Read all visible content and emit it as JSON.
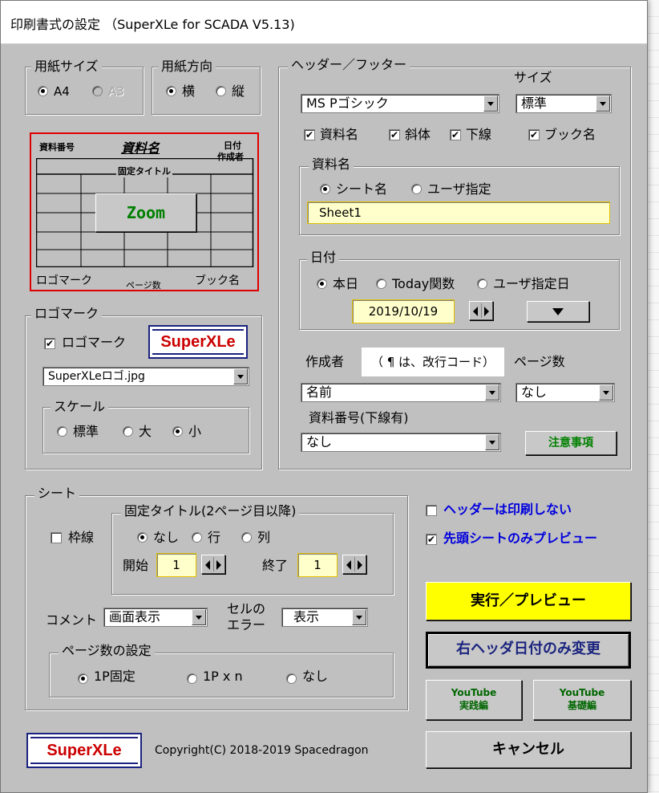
{
  "window": {
    "title": "印刷書式の設定 （SuperXLe for SCADA V5.13)"
  },
  "paper_size": {
    "legend": "用紙サイズ",
    "options": [
      "A4",
      "A3"
    ],
    "selected": "A4"
  },
  "paper_orientation": {
    "legend": "用紙方向",
    "options": [
      "横",
      "縦"
    ],
    "selected": "横"
  },
  "preview": {
    "doc_number": "資料番号",
    "doc_name": "資料名",
    "date": "日付",
    "author": "作成者",
    "fixed_title": "固定タイトル",
    "zoom_button": "Zoom",
    "logo_mark": "ロゴマーク",
    "page_count": "ページ数",
    "book_name": "ブック名"
  },
  "logo": {
    "legend": "ロゴマーク",
    "checkbox_label": "ロゴマーク",
    "checked": true,
    "badge_text": "SuperXLe",
    "file": "SuperXLeロゴ.jpg",
    "scale": {
      "legend": "スケール",
      "options": [
        "標準",
        "大",
        "小"
      ],
      "selected": "小"
    }
  },
  "header_footer": {
    "legend": "ヘッダー／フッター",
    "size_label": "サイズ",
    "font": "MS Pゴシック",
    "size": "標準",
    "checks": [
      {
        "label": "資料名",
        "checked": true
      },
      {
        "label": "斜体",
        "checked": true
      },
      {
        "label": "下線",
        "checked": true
      },
      {
        "label": "ブック名",
        "checked": true
      }
    ],
    "doc_name": {
      "legend": "資料名",
      "options": [
        "シート名",
        "ユーザ指定"
      ],
      "selected": "シート名",
      "value": "Sheet1"
    },
    "date": {
      "legend": "日付",
      "options": [
        "本日",
        "Today関数",
        "ユーザ指定日"
      ],
      "selected": "本日",
      "value": "2019/10/19"
    },
    "author_label": "作成者",
    "author_hint": "（ ¶ は、改行コード）",
    "author_value": "名前",
    "pages_label": "ページ数",
    "pages_value": "なし",
    "doc_number_label": "資料番号(下線有)",
    "doc_number_value": "なし",
    "notes_button": "注意事項"
  },
  "sheet": {
    "legend": "シート",
    "border_label": "枠線",
    "border_checked": false,
    "fixed_title": {
      "legend": "固定タイトル(2ページ目以降)",
      "options": [
        "なし",
        "行",
        "列"
      ],
      "selected": "なし",
      "start_label": "開始",
      "start_value": "1",
      "end_label": "終了",
      "end_value": "1"
    },
    "comment_label": "コメント",
    "comment_value": "画面表示",
    "cell_error_label_1": "セルの",
    "cell_error_label_2": "エラー",
    "cell_error_value": "表示",
    "page_setting": {
      "legend": "ページ数の設定",
      "options": [
        "1P固定",
        "1P x n",
        "なし"
      ],
      "selected": "1P固定"
    }
  },
  "options": {
    "no_header_print": {
      "label": "ヘッダーは印刷しない",
      "checked": false
    },
    "first_sheet_preview": {
      "label": "先頭シートのみプレビュー",
      "checked": true
    }
  },
  "buttons": {
    "run_preview": "実行／プレビュー",
    "right_header_date": "右ヘッダ日付のみ変更",
    "youtube_practice_1": "YouTube",
    "youtube_practice_2": "実践編",
    "youtube_basic_1": "YouTube",
    "youtube_basic_2": "基礎編",
    "cancel": "キャンセル"
  },
  "footer": {
    "logo_text": "SuperXLe",
    "copyright": "Copyright(C) 2018-2019 Spacedragon"
  },
  "colors": {
    "dialog_bg": "#c0c0c0",
    "run_button": "#ffff00",
    "accent_blue": "#0000dd",
    "youtube_green": "#006600",
    "logo_red": "#cc0000",
    "logo_navy": "#1a237e",
    "preview_border": "#dd0000"
  }
}
